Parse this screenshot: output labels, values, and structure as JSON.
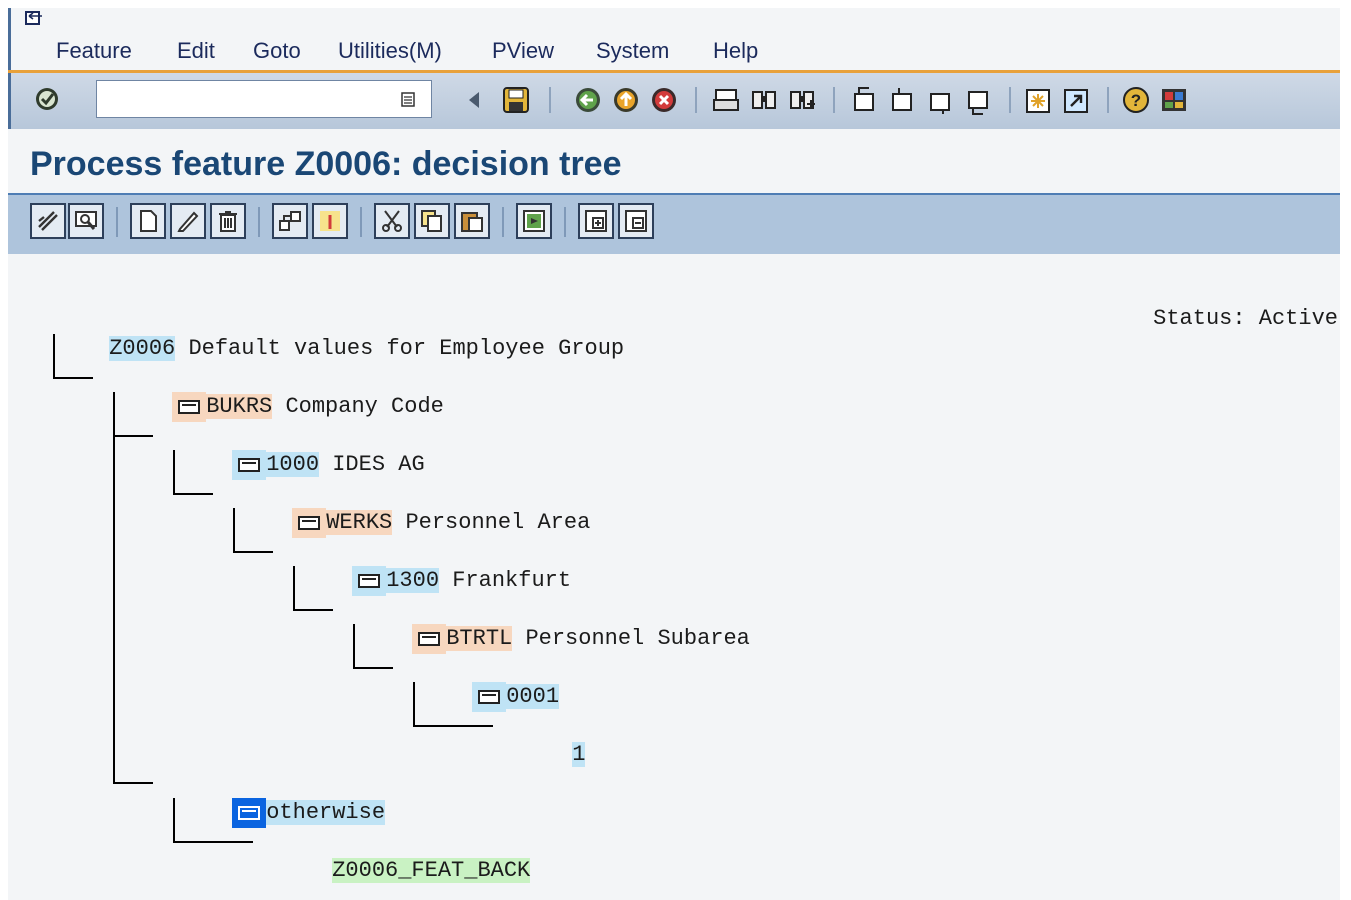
{
  "menu": {
    "items": [
      "Feature",
      "Edit",
      "Goto",
      "Utilities(M)",
      "PView",
      "System",
      "Help"
    ]
  },
  "system_toolbar": {
    "command_field_value": "",
    "icons": [
      "enter-icon",
      "back-arrow-icon",
      "save-icon",
      "back-icon",
      "exit-icon",
      "cancel-icon",
      "print-icon",
      "find-icon",
      "find-next-icon",
      "first-page-icon",
      "previous-page-icon",
      "next-page-icon",
      "last-page-icon",
      "create-session-icon",
      "shortcut-icon",
      "help-icon",
      "customize-layout-icon"
    ]
  },
  "title": "Process feature Z0006: decision tree",
  "app_toolbar": {
    "icons": [
      "check-icon",
      "display-icon",
      "create-icon",
      "change-icon",
      "delete-icon",
      "structure-icon",
      "node-attributes-icon",
      "cut-icon",
      "copy-icon",
      "paste-icon",
      "generate-icon",
      "expand-icon",
      "collapse-icon"
    ]
  },
  "tree": {
    "root": {
      "key": "Z0006",
      "text": "Default values for Employee Group"
    },
    "status": "Status: Active",
    "nodes": [
      {
        "key": "BUKRS",
        "text": "Company Code"
      },
      {
        "key": "1000",
        "text": "IDES AG"
      },
      {
        "key": "WERKS",
        "text": "Personnel Area"
      },
      {
        "key": "1300",
        "text": "Frankfurt"
      },
      {
        "key": "BTRTL",
        "text": "Personnel Subarea"
      },
      {
        "key": "0001",
        "text": ""
      },
      {
        "key": "1",
        "text": ""
      },
      {
        "key": "otherwise",
        "text": ""
      },
      {
        "key": "Z0006_FEAT_BACK",
        "text": ""
      }
    ]
  },
  "colors": {
    "field_highlight": "#f7d7bf",
    "value_highlight": "#bfe3f5",
    "selected": "#0a64e0",
    "return_highlight": "#c9f2c3",
    "title": "#1a4775"
  }
}
